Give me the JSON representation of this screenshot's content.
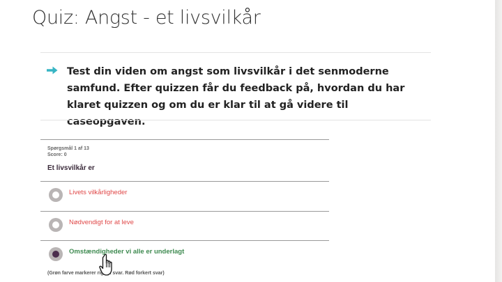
{
  "page": {
    "title": "Quiz: Angst - et livsvilkår"
  },
  "intro": {
    "icon": "arrow-right-icon",
    "text": "Test din viden om angst som livsvilkår i det senmoderne samfund. Efter quizzen får du feedback på, hvordan du har klaret quizzen og om du er klar til at gå videre til caseopgaven."
  },
  "quiz": {
    "progress": "Spørgsmål 1 af 13",
    "score": "Score: 0",
    "question": "Et livsvilkår er",
    "options": [
      {
        "label": "Livets vilkårligheder",
        "state": "wrong"
      },
      {
        "label": "Nødvendigt for at leve",
        "state": "wrong"
      },
      {
        "label": "Omstændigheder vi alle er underlagt",
        "state": "correct-selected"
      }
    ],
    "legend": "(Grøn farve markerer rigtigt svar. Rød forkert svar)"
  },
  "colors": {
    "accent_arrow": "#37b5c4",
    "wrong": "#e04848",
    "correct": "#3e8a50",
    "radio_selected": "#4b2e4d",
    "radio_ring": "#b9b5b5"
  },
  "cursor": {
    "icon": "hand-pointer-icon"
  }
}
